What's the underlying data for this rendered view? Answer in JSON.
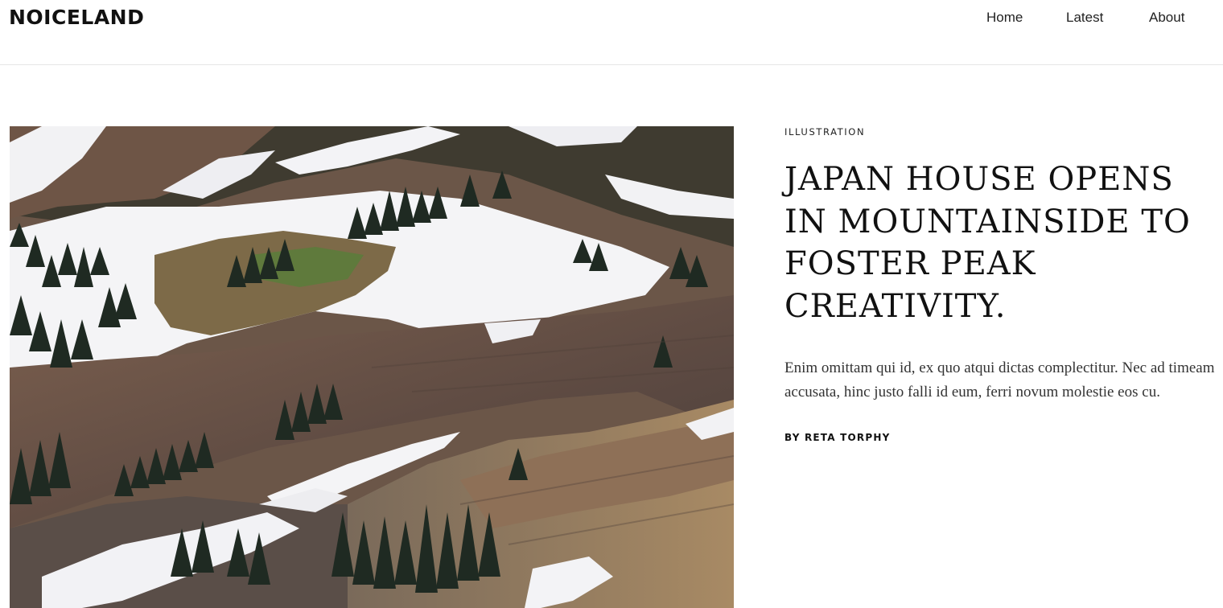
{
  "header": {
    "brand": "NOICELAND",
    "nav": [
      {
        "label": "Home"
      },
      {
        "label": "Latest"
      },
      {
        "label": "About"
      }
    ]
  },
  "article": {
    "category": "ILLUSTRATION",
    "title": "JAPAN HOUSE OPENS IN MOUNTAINSIDE TO FOSTER PEAK CREATIVITY.",
    "excerpt": "Enim omittam qui id, ex quo atqui dictas complectitur. Nec ad timeam accusata, hinc justo falli id eum, ferri novum molestie eos cu.",
    "byline": "BY RETA TORPHY"
  }
}
